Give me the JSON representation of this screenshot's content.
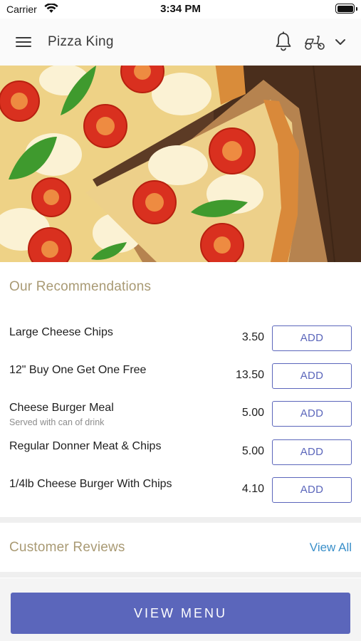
{
  "status_bar": {
    "carrier": "Carrier",
    "time": "3:34 PM"
  },
  "header": {
    "title": "Pizza King",
    "icons": [
      "menu-icon",
      "bell-icon",
      "scooter-icon",
      "chevron-down-icon"
    ]
  },
  "hero": {
    "image": "pizza-photo"
  },
  "recommendations": {
    "title": "Our Recommendations",
    "items": [
      {
        "name": "Large Cheese Chips",
        "subtitle": "",
        "price": "3.50",
        "button": "ADD"
      },
      {
        "name": "12\" Buy One Get One Free",
        "subtitle": "",
        "price": "13.50",
        "button": "ADD"
      },
      {
        "name": "Cheese Burger Meal",
        "subtitle": "Served with can of drink",
        "price": "5.00",
        "button": "ADD"
      },
      {
        "name": "Regular Donner Meat & Chips",
        "subtitle": "",
        "price": "5.00",
        "button": "ADD"
      },
      {
        "name": "1/4lb Cheese Burger With Chips",
        "subtitle": "",
        "price": "4.10",
        "button": "ADD"
      }
    ]
  },
  "reviews": {
    "title": "Customer Reviews",
    "view_all": "View All"
  },
  "footer": {
    "view_menu": "VIEW MENU"
  },
  "colors": {
    "accent": "#5b66bb",
    "section_title": "#a99a74",
    "link": "#3a8fc9"
  }
}
